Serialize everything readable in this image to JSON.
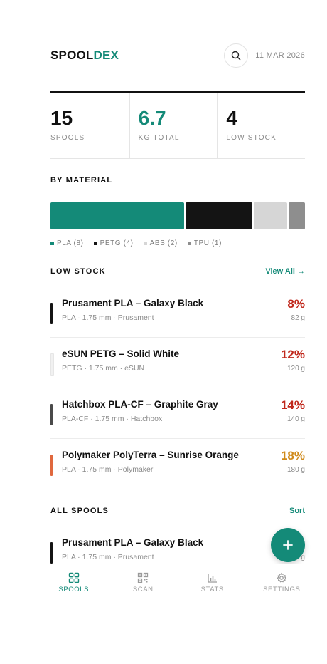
{
  "header": {
    "logo_part1": "SPOOL",
    "logo_part2": "DEX",
    "date": "11 MAR 2026",
    "search_icon": "search-icon"
  },
  "stats": [
    {
      "value": "15",
      "label": "SPOOLS"
    },
    {
      "value": "6.7",
      "label": "KG TOTAL"
    },
    {
      "value": "4",
      "label": "LOW STOCK"
    }
  ],
  "by_material": {
    "title": "BY MATERIAL",
    "segments": [
      {
        "name": "PLA",
        "count": 8,
        "color": "#148a78"
      },
      {
        "name": "PETG",
        "count": 4,
        "color": "#141414"
      },
      {
        "name": "ABS",
        "count": 2,
        "color": "#d6d6d6"
      },
      {
        "name": "TPU",
        "count": 1,
        "color": "#8e8e8e"
      }
    ],
    "legend": [
      {
        "label": "PLA (8)",
        "color": "#148a78"
      },
      {
        "label": "PETG (4)",
        "color": "#141414"
      },
      {
        "label": "ABS (2)",
        "color": "#d6d6d6"
      },
      {
        "label": "TPU (1)",
        "color": "#8e8e8e"
      }
    ]
  },
  "low_stock": {
    "title": "LOW STOCK",
    "link": "View All →",
    "items": [
      {
        "name": "Prusament PLA – Galaxy Black",
        "meta": "PLA · 1.75 mm · Prusament",
        "pct": "8%",
        "weight": "82 g",
        "swatch": "#141414",
        "pct_color": "#c0281c"
      },
      {
        "name": "eSUN PETG – Solid White",
        "meta": "PETG · 1.75 mm · eSUN",
        "pct": "12%",
        "weight": "120 g",
        "swatch": "#f1f1f1",
        "pct_color": "#c0281c"
      },
      {
        "name": "Hatchbox PLA-CF – Graphite Gray",
        "meta": "PLA-CF · 1.75 mm · Hatchbox",
        "pct": "14%",
        "weight": "140 g",
        "swatch": "#4a4a4a",
        "pct_color": "#c0281c"
      },
      {
        "name": "Polymaker PolyTerra – Sunrise Orange",
        "meta": "PLA · 1.75 mm · Polymaker",
        "pct": "18%",
        "weight": "180 g",
        "swatch": "#e0683e",
        "pct_color": "#d08a1a"
      }
    ]
  },
  "all_spools": {
    "title": "ALL SPOOLS",
    "link": "Sort",
    "items": [
      {
        "name": "Prusament PLA – Galaxy Black",
        "meta": "PLA · 1.75 mm · Prusament",
        "pct": "",
        "weight": "82 g",
        "swatch": "#141414",
        "pct_color": "#c0281c"
      }
    ]
  },
  "fab": {
    "icon": "plus-icon",
    "color": "#148a78"
  },
  "nav": [
    {
      "label": "SPOOLS",
      "icon": "grid-icon",
      "active": true
    },
    {
      "label": "SCAN",
      "icon": "qr-icon",
      "active": false
    },
    {
      "label": "STATS",
      "icon": "bar-chart-icon",
      "active": false
    },
    {
      "label": "SETTINGS",
      "icon": "gear-icon",
      "active": false
    }
  ]
}
